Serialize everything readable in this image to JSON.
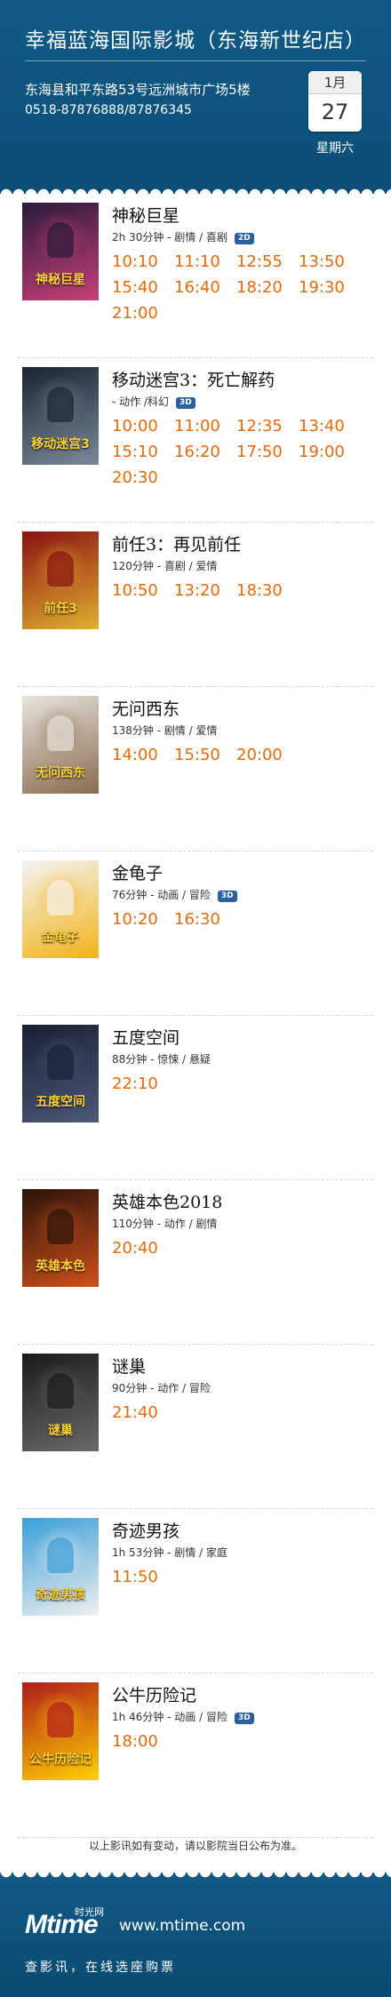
{
  "header": {
    "cinema_name": "幸福蓝海国际影城（东海新世纪店）",
    "address": "东海县和平东路53号远洲城市广场5楼",
    "phone": "0518-87876888/87876345",
    "month": "1月",
    "day": "27",
    "weekday": "星期六"
  },
  "colors": {
    "header_bg": "#0f5a86",
    "showtime": "#e56a0b"
  },
  "movies": [
    {
      "title": "神秘巨星",
      "meta": "2h 30分钟 - 剧情 / 喜剧",
      "badge": "2D",
      "poster_text": "神秘巨星",
      "poster_colors": [
        "#2a1a3a",
        "#c7407a"
      ],
      "times": [
        "10:10",
        "11:10",
        "12:55",
        "13:50",
        "15:40",
        "16:40",
        "18:20",
        "19:30",
        "21:00"
      ]
    },
    {
      "title": "移动迷宫3：死亡解药",
      "meta": "- 动作 /科幻",
      "badge": "3D",
      "poster_text": "移动迷宫3",
      "poster_colors": [
        "#1b2430",
        "#7a8a99"
      ],
      "times": [
        "10:00",
        "11:00",
        "12:35",
        "13:40",
        "15:10",
        "16:20",
        "17:50",
        "19:00",
        "20:30"
      ]
    },
    {
      "title": "前任3：再见前任",
      "meta": "120分钟 - 喜剧 / 爱情",
      "badge": "",
      "poster_text": "前任3",
      "poster_colors": [
        "#8a1010",
        "#e0b030"
      ],
      "times": [
        "10:50",
        "13:20",
        "18:30"
      ]
    },
    {
      "title": "无问西东",
      "meta": "138分钟 - 剧情 / 爱情",
      "badge": "",
      "poster_text": "无问西东",
      "poster_colors": [
        "#e8e4dc",
        "#8a6a50"
      ],
      "times": [
        "14:00",
        "15:50",
        "20:00"
      ]
    },
    {
      "title": "金龟子",
      "meta": "76分钟 - 动画 / 冒险",
      "badge": "3D",
      "poster_text": "金龟子",
      "poster_colors": [
        "#f4f4f4",
        "#f2b316"
      ],
      "times": [
        "10:20",
        "16:30"
      ]
    },
    {
      "title": "五度空间",
      "meta": "88分钟 - 惊悚 / 悬疑",
      "badge": "",
      "poster_text": "五度空间",
      "poster_colors": [
        "#1a2033",
        "#4a5a7a"
      ],
      "times": [
        "22:10"
      ]
    },
    {
      "title": "英雄本色2018",
      "meta": "110分钟 - 动作 / 剧情",
      "badge": "",
      "poster_text": "英雄本色",
      "poster_colors": [
        "#2a120a",
        "#d0501a"
      ],
      "times": [
        "20:40"
      ]
    },
    {
      "title": "谜巢",
      "meta": "90分钟 - 动作 / 冒险",
      "badge": "",
      "poster_text": "谜巢",
      "poster_colors": [
        "#1a1a1a",
        "#6a6a6a"
      ],
      "times": [
        "21:40"
      ]
    },
    {
      "title": "奇迹男孩",
      "meta": "1h 53分钟 - 剧情 / 家庭",
      "badge": "",
      "poster_text": "奇迹男孩",
      "poster_colors": [
        "#3a9ed8",
        "#f0f0f0"
      ],
      "times": [
        "11:50"
      ]
    },
    {
      "title": "公牛历险记",
      "meta": "1h 46分钟 - 动画 / 冒险",
      "badge": "3D",
      "poster_text": "公牛历险记",
      "poster_colors": [
        "#b01a1a",
        "#ffd200"
      ],
      "times": [
        "18:00"
      ]
    }
  ],
  "note": "以上影讯如有变动，请以影院当日公布为准。",
  "footer": {
    "logo": "Mtime",
    "logo_sub": "时光网",
    "site": "www.mtime.com",
    "slogan": "查影讯，在线选座购票"
  }
}
